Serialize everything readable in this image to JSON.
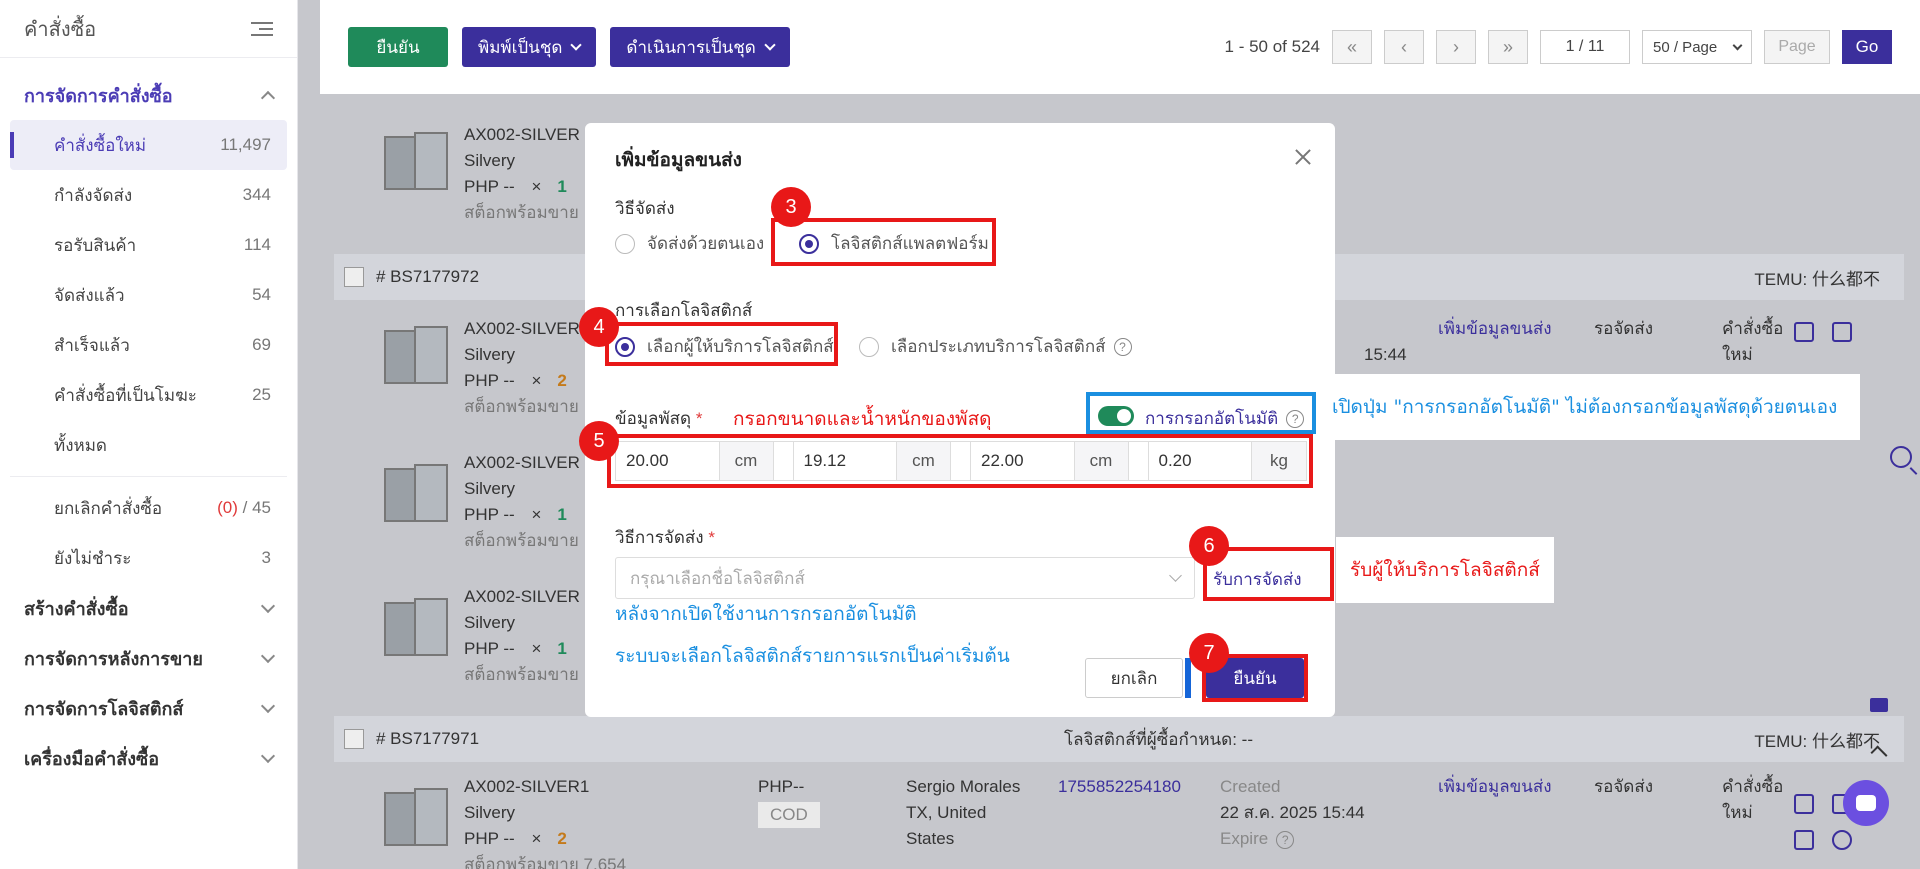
{
  "sidebar": {
    "title": "คำสั่งซื้อ",
    "section_order_mgmt": "การจัดการคำสั่งซื้อ",
    "items": [
      {
        "label": "คำสั่งซื้อใหม่",
        "count": "11,497"
      },
      {
        "label": "กำลังจัดส่ง",
        "count": "344"
      },
      {
        "label": "รอรับสินค้า",
        "count": "114"
      },
      {
        "label": "จัดส่งแล้ว",
        "count": "54"
      },
      {
        "label": "สำเร็จแล้ว",
        "count": "69"
      },
      {
        "label": "คำสั่งซื้อที่เป็นโมฆะ",
        "count": "25"
      },
      {
        "label": "ทั้งหมด",
        "count": ""
      }
    ],
    "cancel_item": {
      "label": "ยกเลิกคำสั่งซื้อ",
      "count_red": "(0)",
      "count_sep": " / ",
      "count_total": "45"
    },
    "unpaid_item": {
      "label": "ยังไม่ชำระ",
      "count": "3"
    },
    "sections": [
      "สร้างคำสั่งซื้อ",
      "การจัดการหลังการขาย",
      "การจัดการโลจิสติกส์",
      "เครื่องมือคำสั่งซื้อ"
    ]
  },
  "toolbar": {
    "confirm": "ยืนยัน",
    "batch_print": "พิมพ์เป็นชุด",
    "batch_process": "ดำเนินการเป็นชุด",
    "range": "1 - 50 of 524",
    "first": "«",
    "prev": "‹",
    "next": "›",
    "last": "»",
    "page_indicator": "1 / 11",
    "per_page": "50 / Page",
    "page_placeholder": "Page",
    "go": "Go"
  },
  "orders": [
    {
      "id": "# BS7177972",
      "platform": "TEMU: 什么都不"
    },
    {
      "id": "# BS7177971",
      "platform": "TEMU: 什么都不",
      "logistics_note": "โลจิสติกส์ที่ผู้ซื้อกำหนด: --"
    }
  ],
  "product": {
    "sku": "AX002-SILVER",
    "sku_full": "AX002-SILVER1",
    "color": "Silvery",
    "price": "PHP --",
    "times": "×",
    "stock": "สต็อกพร้อมขาย",
    "stock_cut": "สต็อกพร้อมขาย 7,654"
  },
  "qty": [
    "1",
    "2",
    "1",
    "1",
    "2"
  ],
  "row_cells": {
    "add_shipping": "เพิ่มข้อมูลขนส่ง",
    "pending": "รอจัดส่ง",
    "new_order_line1": "คำสั่งซื้อ",
    "new_order_line2": "ใหม่",
    "time_partial": "15:44",
    "payment": "PHP--",
    "cod": "COD",
    "buyer_name": "Sergio Morales",
    "buyer_loc1": "TX, United",
    "buyer_loc2": "States",
    "tracking": "1755852254180",
    "created_label": "Created",
    "created_date": "22 ส.ค. 2025 15:44",
    "expire_label": "Expire"
  },
  "modal": {
    "title": "เพิ่มข้อมูลขนส่ง",
    "ship_method_label": "วิธีจัดส่ง",
    "opt_self": "จัดส่งด้วยตนเอง",
    "opt_platform": "โลจิสติกส์แพลตฟอร์ม",
    "logistics_choice_label": "การเลือกโลจิสติกส์",
    "opt_provider": "เลือกผู้ให้บริการโลจิสติกส์",
    "opt_service_type": "เลือกประเภทบริการโลจิสติกส์",
    "parcel_label": "ข้อมูลพัสดุ",
    "required": "*",
    "auto_fill": "การกรอกอัตโนมัติ",
    "dims": [
      {
        "value": "20.00",
        "unit": "cm"
      },
      {
        "value": "19.12",
        "unit": "cm"
      },
      {
        "value": "22.00",
        "unit": "cm"
      },
      {
        "value": "0.20",
        "unit": "kg"
      }
    ],
    "delivery_method_label": "วิธีการจัดส่ง",
    "delivery_placeholder": "กรุณาเลือกชื่อโลจิสติกส์",
    "get_delivery": "รับการจัดส่ง",
    "cancel": "ยกเลิก",
    "confirm": "ยืนยัน",
    "help": "?"
  },
  "annotations": {
    "badge3": "3",
    "badge4": "4",
    "badge5": "5",
    "badge6": "6",
    "badge7": "7",
    "fill_size_weight": "กรอกขนาดและน้ำหนักของพัสดุ",
    "auto_fill_tip": "เปิดปุ่ม \"การกรอกอัตโนมัติ\" ไม่ต้องกรอกข้อมูลพัสดุด้วยตนเอง",
    "get_provider_tip": "รับผู้ให้บริการโลจิสติกส์",
    "after_enable_line1": "หลังจากเปิดใช้งานการกรอกอัตโนมัติ",
    "after_enable_line2": "ระบบจะเลือกโลจิสติกส์รายการแรกเป็นค่าเริ่มต้น"
  },
  "colors": {
    "brand_purple": "#3b2f9c",
    "confirm_green": "#1f8a5a",
    "annotation_red": "#e81818",
    "annotation_blue": "#1a8fe0"
  }
}
